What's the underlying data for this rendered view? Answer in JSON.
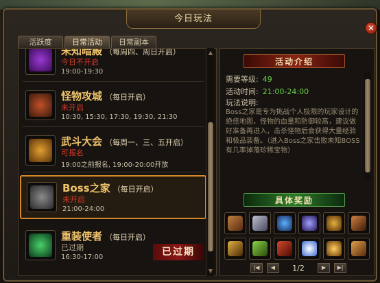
{
  "window": {
    "title": "今日玩法",
    "close": "✕"
  },
  "tabs": [
    {
      "label": "活跃度"
    },
    {
      "label": "日常活动"
    },
    {
      "label": "日常副本"
    }
  ],
  "activities": [
    {
      "name": "未知暗殿",
      "freq": "（每周四、周日开启）",
      "status": "今日不开启",
      "time": "19:00-19:30"
    },
    {
      "name": "怪物攻城",
      "freq": "（每日开启）",
      "status": "未开启",
      "time": "10:30, 15:30, 17:30, 19:30, 21:30"
    },
    {
      "name": "武斗大会",
      "freq": "（每周一、三、五开启）",
      "status": "可报名",
      "time": "19:00之前报名, 19:00-20:00开放"
    },
    {
      "name": "Boss之家",
      "freq": "（每日开启）",
      "status": "未开启",
      "time": "21:00-24:00"
    },
    {
      "name": "重装使者",
      "freq": "（每日开启）",
      "status": "已过期",
      "time": "16:30-17:00"
    }
  ],
  "expired_badge": "已过期",
  "detail": {
    "intro_title": "活动介绍",
    "level_label": "需要等级:",
    "level_value": "49",
    "time_label": "活动时间:",
    "time_value": "21:00-24:00",
    "desc_label": "玩法说明:",
    "desc_text": "Boss之家是专为挑战个人极限的玩家设计的绝佳地图，怪物的血量和防御较高，建议做好准备再进入，击杀怪物后会获得大量经验和极品装备。（进入Boss之家击败未知BOSS有几率掉落珍稀宝物）",
    "reward_title": "具体奖励",
    "page": "1/2"
  },
  "colors": {
    "accent_gold": "#f0c46a",
    "status_red": "#d43a2a",
    "level_green": "#6ad24a"
  }
}
